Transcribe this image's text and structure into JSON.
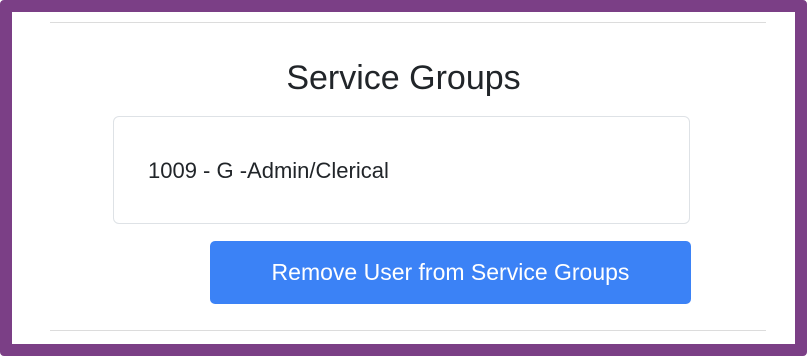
{
  "section": {
    "title": "Service Groups",
    "groups": [
      {
        "label": "1009 - G -Admin/Clerical"
      }
    ],
    "remove_button_label": "Remove User from Service Groups"
  },
  "colors": {
    "frame_border": "#7b3f86",
    "button_background": "#3b82f6",
    "button_text": "#ffffff",
    "text": "#212529",
    "divider": "#dcdcdc"
  }
}
